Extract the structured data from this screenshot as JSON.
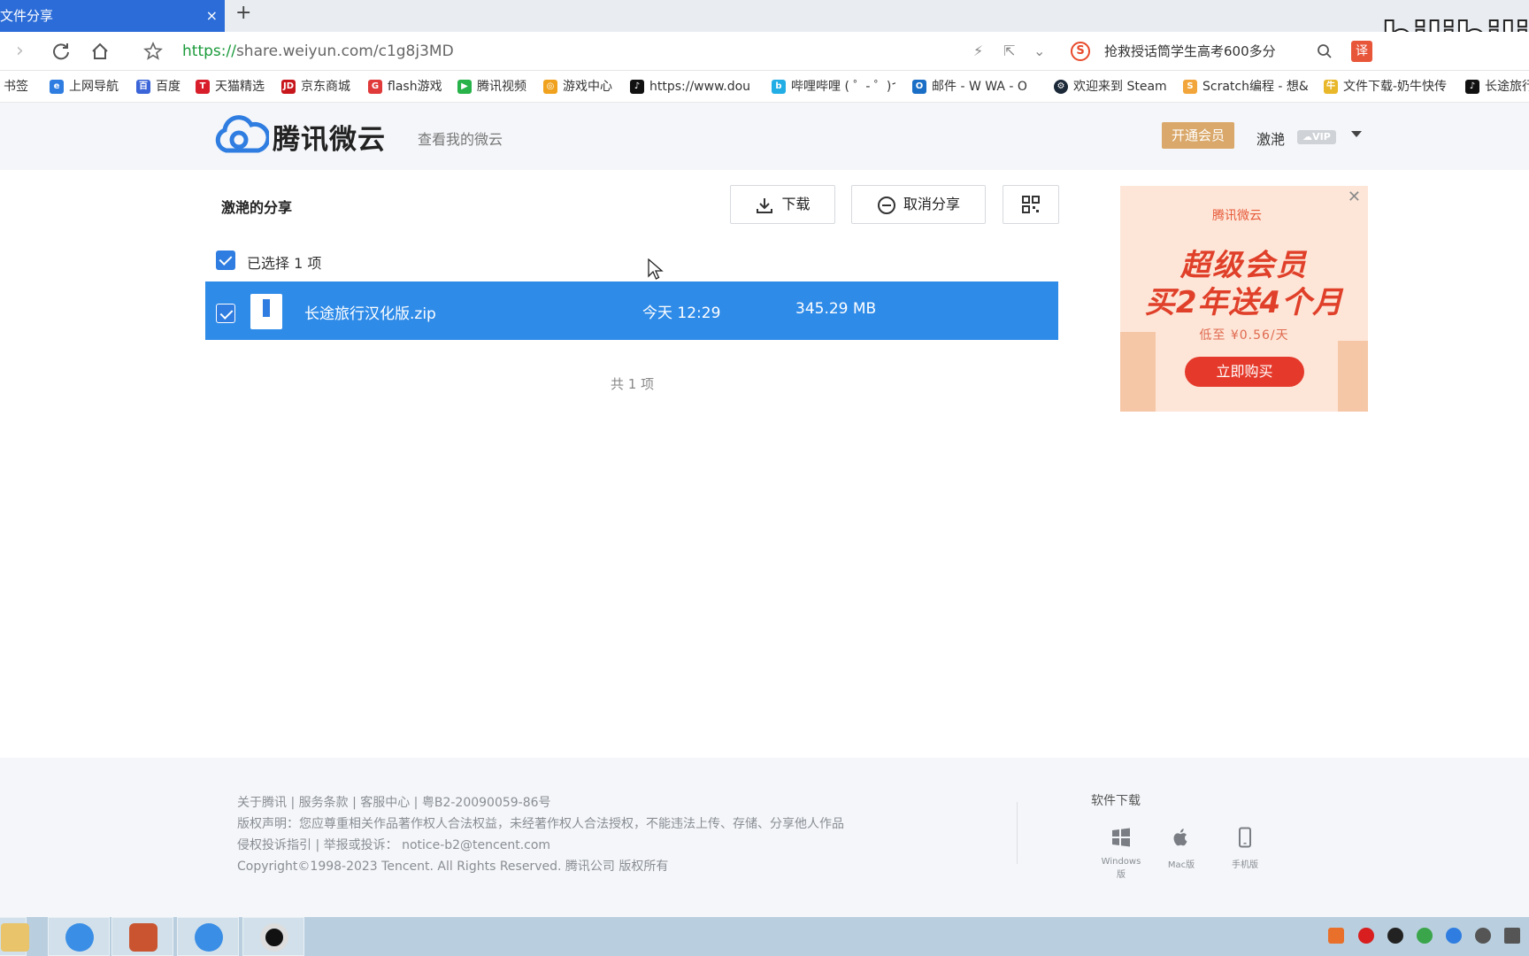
{
  "browser": {
    "tab_title": "文件分享",
    "tab_close": "×",
    "new_tab": "+",
    "watermark": "bilibili",
    "url_scheme": "https://",
    "url_host": "share.weiyun.com/c1g8j3MD",
    "search_suggestion": "抢救授话筒学生高考600多分",
    "translate_label": "译"
  },
  "bookmarks": [
    {
      "label": "书签",
      "color": "#ffffff"
    },
    {
      "label": "上网导航",
      "color": "#2f7de1"
    },
    {
      "label": "百度",
      "color": "#3a64d8"
    },
    {
      "label": "天猫精选",
      "color": "#d81e2a"
    },
    {
      "label": "京东商城",
      "color": "#c8161d"
    },
    {
      "label": "flash游戏",
      "color": "#e03a3a"
    },
    {
      "label": "腾讯视频",
      "color": "#27b24a"
    },
    {
      "label": "游戏中心",
      "color": "#f0a21e"
    },
    {
      "label": "https://www.dou",
      "color": "#111111"
    },
    {
      "label": "哔哩哔哩 ( ゜- ゜)つ",
      "color": "#23ade5"
    },
    {
      "label": "邮件 - W WA - O",
      "color": "#1a6ec6"
    },
    {
      "label": "欢迎来到 Steam",
      "color": "#1b2838"
    },
    {
      "label": "Scratch编程 - 想&",
      "color": "#f2a53a"
    },
    {
      "label": "文件下载-奶牛快传",
      "color": "#e9b72a"
    },
    {
      "label": "长途旅行",
      "color": "#111111"
    }
  ],
  "header": {
    "brand": "腾讯微云",
    "my_weiyun": "查看我的微云",
    "open_vip": "开通会员",
    "username": "激滟",
    "vip_tag": "VIP"
  },
  "share": {
    "title": "激滟的分享",
    "download_label": "下载",
    "cancel_share_label": "取消分享",
    "selected_text": "已选择 1 项",
    "total_text": "共 1 项"
  },
  "files": [
    {
      "name": "长途旅行汉化版.zip",
      "time": "今天 12:29",
      "size": "345.29 MB",
      "selected": true
    }
  ],
  "ad": {
    "brand": "腾讯微云",
    "line1": "超级会员",
    "line2": "买2年送4个月",
    "price": "低至 ¥0.56/天",
    "buy": "立即购买"
  },
  "footer": {
    "links": "关于腾讯 | 服务条款 | 客服中心 | 粤B2-20090059-86号",
    "copyright_notice": "版权声明：您应尊重相关作品著作权人合法权益，未经著作权人合法授权，不能违法上传、存储、分享他人作品",
    "report": "侵权投诉指引 | 举报或投诉： notice-b2@tencent.com",
    "copyright": "Copyright©1998-2023 Tencent. All Rights Reserved. 腾讯公司 版权所有",
    "software_title": "软件下载",
    "software": [
      {
        "label": "Windows版",
        "icon": "windows-icon"
      },
      {
        "label": "Mac版",
        "icon": "apple-icon"
      },
      {
        "label": "手机版",
        "icon": "phone-icon"
      }
    ]
  },
  "colors": {
    "accent": "#2f8be8",
    "vip_gold": "#d9a86a",
    "tab_blue": "#2b6cd8",
    "ad_red": "#e53a2b"
  }
}
